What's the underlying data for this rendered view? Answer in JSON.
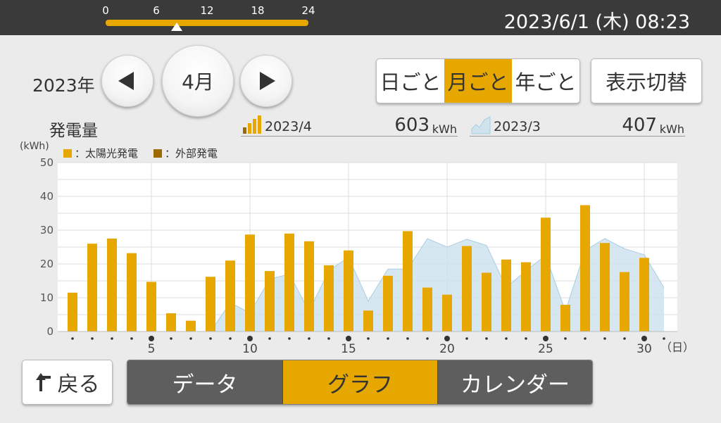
{
  "header": {
    "timeline_ticks": [
      "0",
      "6",
      "12",
      "18",
      "24"
    ],
    "timeline_position_hours": 8.4,
    "datetime": "2023/6/1 (木) 08:23"
  },
  "nav": {
    "year_label": "2023年",
    "month_label": "4月",
    "prev_icon": "triangle-left-icon",
    "next_icon": "triangle-right-icon"
  },
  "period_tabs": [
    {
      "label": "日ごと",
      "active": false
    },
    {
      "label": "月ごと",
      "active": true
    },
    {
      "label": "年ごと",
      "active": false
    }
  ],
  "toggle_label": "表示切替",
  "generation": {
    "title": "発電量",
    "current": {
      "period": "2023/4",
      "value": "603",
      "unit": "kWh"
    },
    "previous": {
      "period": "2023/3",
      "value": "407",
      "unit": "kWh"
    }
  },
  "colors": {
    "solar": "#e6a800",
    "external": "#9c6a00",
    "previous_area": "#cfe3ef",
    "previous_line": "#a9cde2"
  },
  "chart_data": {
    "type": "bar",
    "ylabel": "(kWh)",
    "xunit": "（日）",
    "ylim": [
      0,
      50
    ],
    "yticks": [
      0,
      10,
      20,
      30,
      40,
      50
    ],
    "x_tick_labels": [
      5,
      10,
      15,
      20,
      25,
      30
    ],
    "legend": [
      {
        "name": "：太陽光発電",
        "color": "#e6a800"
      },
      {
        "name": "：外部発電",
        "color": "#9c6a00"
      }
    ],
    "legend_position": "top-left",
    "grid": true,
    "days": [
      1,
      2,
      3,
      4,
      5,
      6,
      7,
      8,
      9,
      10,
      11,
      12,
      13,
      14,
      15,
      16,
      17,
      18,
      19,
      20,
      21,
      22,
      23,
      24,
      25,
      26,
      27,
      28,
      29,
      30
    ],
    "series": [
      {
        "name": "2023/4",
        "type": "bar",
        "values": [
          11.5,
          26,
          27.5,
          23.2,
          14.7,
          5.4,
          3.2,
          16.2,
          21,
          28.7,
          17.9,
          29,
          26.7,
          19.6,
          24,
          6.2,
          16.5,
          29.7,
          13,
          10.9,
          25.3,
          17.4,
          21.3,
          20.5,
          33.7,
          7.9,
          37.4,
          26.2,
          17.6,
          21.8
        ]
      },
      {
        "name": "2023/3",
        "type": "area",
        "values": [
          0,
          0,
          0,
          0,
          0,
          0,
          0,
          0,
          8.5,
          5.5,
          15.5,
          17,
          6,
          18,
          22,
          9,
          18.5,
          18.5,
          27.5,
          25,
          27.3,
          25.5,
          13,
          18,
          22.5,
          6,
          24,
          27.5,
          24.5,
          22.7,
          13
        ]
      }
    ]
  },
  "back_label": "戻る",
  "bottom_tabs": [
    {
      "label": "データ",
      "active": false
    },
    {
      "label": "グラフ",
      "active": true
    },
    {
      "label": "カレンダー",
      "active": false
    }
  ]
}
